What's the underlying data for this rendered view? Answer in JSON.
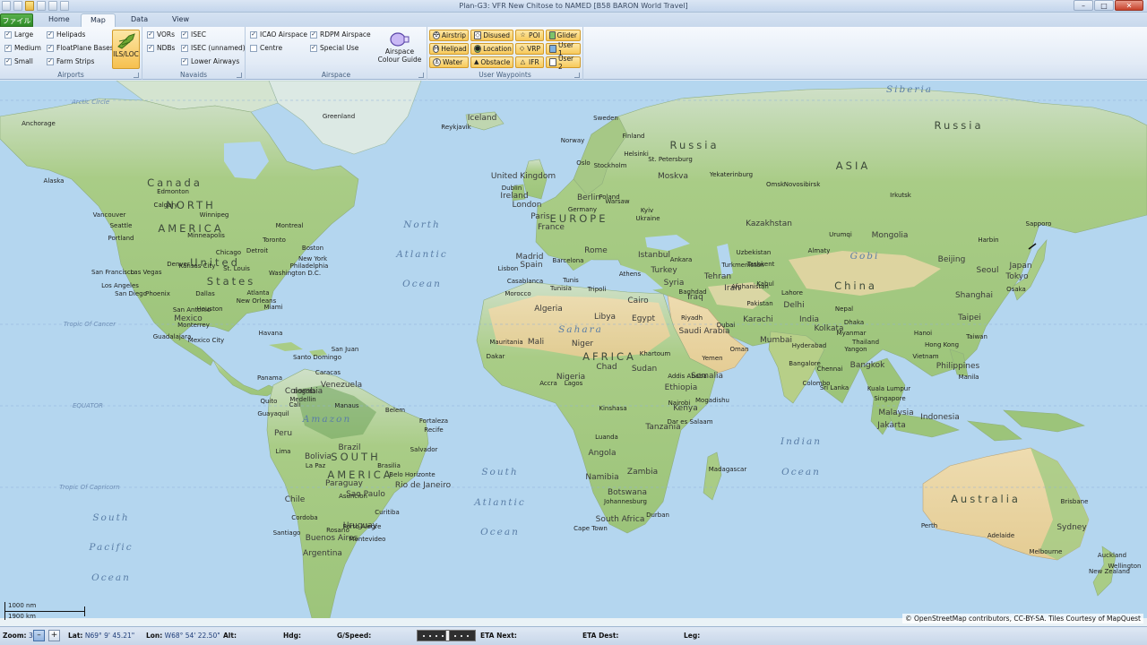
{
  "app": {
    "title": "Plan-G3: VFR New Chitose to NAMED [B58 BARON World Travel]",
    "window_buttons": [
      "–",
      "□",
      "✕"
    ]
  },
  "tabs": [
    {
      "label": "ファイル"
    },
    {
      "label": "Home"
    },
    {
      "label": "Map"
    },
    {
      "label": "Data"
    },
    {
      "label": "View"
    }
  ],
  "ribbon": {
    "airports": {
      "label": "Airports",
      "large": "Large",
      "medium": "Medium",
      "small": "Small",
      "helipads": "Helipads",
      "floatplane": "FloatPlane Bases",
      "farm": "Farm Strips",
      "ils": "ILS/LOC"
    },
    "navaids": {
      "label": "Navaids",
      "vors": "VORs",
      "ndbs": "NDBs",
      "isec": "ISEC",
      "isec_unnamed": "ISEC (unnamed)",
      "lower_airways": "Lower Airways"
    },
    "airspace": {
      "label": "Airspace",
      "icao": "ICAO Airspace",
      "centre": "Centre",
      "rdpm": "RDPM Airspace",
      "special": "Special Use",
      "colour_guide_1": "Airspace",
      "colour_guide_2": "Colour Guide"
    },
    "user_waypoints": {
      "label": "User Waypoints",
      "airstrip": "Airstrip",
      "helipad": "Helipad",
      "water": "Water",
      "disused": "Disused",
      "location": "Location",
      "obstacle": "Obstacle",
      "poi": "POI",
      "vrp": "VRP",
      "ifr": "IFR",
      "glider": "Glider",
      "user1": "User 1",
      "user2": "User 2"
    },
    "check_mark": "✓"
  },
  "map": {
    "attribution": "© OpenStreetMap contributors, CC-BY-SA. Tiles Courtesy of MapQuest",
    "scale_top": "1000 nm",
    "scale_bottom": "1900 km",
    "big_labels": [
      "Canada",
      "NORTH",
      "AMERICA",
      "United",
      "States",
      "SOUTH",
      "AMERICA",
      "AFRICA",
      "EUROPE",
      "ASIA",
      "Russia",
      "Russia",
      "China",
      "Australia",
      "Sahara",
      "Amazon",
      "Siberia",
      "Gobi"
    ],
    "oceans": [
      "North",
      "Atlantic",
      "Ocean",
      "South",
      "Atlantic",
      "Ocean",
      "Indian",
      "Ocean",
      "South",
      "Pacific",
      "Ocean"
    ],
    "notes": [
      "Arctic Circle",
      "Tropic Of Cancer",
      "EQUATOR",
      "Tropic Of Capricorn"
    ],
    "countries": [
      "Mexico",
      "Brazil",
      "Peru",
      "Bolivia",
      "Argentina",
      "Chile",
      "Paraguay",
      "Uruguay",
      "Colombia",
      "Venezuela",
      "Algeria",
      "Libya",
      "Egypt",
      "Niger",
      "Chad",
      "Sudan",
      "Mali",
      "Mauritania",
      "Nigeria",
      "Ethiopia",
      "Somalia",
      "Namibia",
      "Botswana",
      "Zambia",
      "Angola",
      "South Africa",
      "Kenya",
      "Tanzania",
      "Kazakhstan",
      "Mongolia",
      "Iran",
      "Iraq",
      "Syria",
      "Turkey",
      "Saudi Arabia",
      "Pakistan",
      "India",
      "Japan",
      "Indonesia",
      "Philippines",
      "Thailand",
      "Vietnam",
      "Myanmar",
      "Spain",
      "France",
      "Germany",
      "Ukraine",
      "Poland",
      "Finland",
      "Sweden",
      "Norway",
      "Iceland",
      "Ireland",
      "United Kingdom",
      "Greenland",
      "Alaska",
      "Madagascar",
      "New Zealand",
      "Afghanistan",
      "Uzbekistan",
      "Turkmenistan",
      "Yemen",
      "Oman",
      "Morocco",
      "Tunisia",
      "Nepal",
      "Malaysia",
      "Sri Lanka",
      "Taiwan"
    ],
    "cities": [
      "Edmonton",
      "Calgary",
      "Vancouver",
      "Seattle",
      "Portland",
      "San Francisco",
      "Los Angeles",
      "San Diego",
      "Las Vegas",
      "Phoenix",
      "Denver",
      "Dallas",
      "Houston",
      "San Antonio",
      "Chicago",
      "Detroit",
      "Toronto",
      "Montreal",
      "Boston",
      "New York",
      "Philadelphia",
      "Washington D.C.",
      "Atlanta",
      "Miami",
      "New Orleans",
      "Havana",
      "Guadalajara",
      "Mexico City",
      "Bogota",
      "Caracas",
      "Lima",
      "Quito",
      "Manaus",
      "Salvador",
      "Recife",
      "Rio de Janeiro",
      "Sao Paulo",
      "Brasilia",
      "Buenos Aires",
      "Montevideo",
      "Santiago",
      "Cordoba",
      "Reykjavik",
      "London",
      "Dublin",
      "Paris",
      "Madrid",
      "Lisbon",
      "Barcelona",
      "Rome",
      "Berlin",
      "Warsaw",
      "Kyiv",
      "Moskva",
      "St. Petersburg",
      "Stockholm",
      "Oslo",
      "Helsinki",
      "Istanbul",
      "Athens",
      "Ankara",
      "Cairo",
      "Tehran",
      "Baghdad",
      "Riyadh",
      "Dubai",
      "Karachi",
      "Mumbai",
      "Delhi",
      "Kolkata",
      "Dhaka",
      "Chennai",
      "Bangkok",
      "Hong Kong",
      "Shanghai",
      "Beijing",
      "Seoul",
      "Tokyo",
      "Osaka",
      "Manila",
      "Jakarta",
      "Singapore",
      "Kuala Lumpur",
      "Perth",
      "Adelaide",
      "Melbourne",
      "Sydney",
      "Brisbane",
      "Auckland",
      "Wellington",
      "Lagos",
      "Accra",
      "Dakar",
      "Kinshasa",
      "Luanda",
      "Nairobi",
      "Dar es Salaam",
      "Johannesburg",
      "Cape Town",
      "Durban",
      "Khartoum",
      "Addis Ababa",
      "Mogadishu",
      "Casablanca",
      "Tripoli",
      "Tunis",
      "Almaty",
      "Tashkent",
      "Urumqi",
      "Novosibirsk",
      "Omsk",
      "Yekaterinburg",
      "Irkutsk",
      "Harbin",
      "Sapporo",
      "Taipei",
      "Hanoi",
      "Yangon",
      "Kabul",
      "Lahore",
      "Hyderabad",
      "Bangalore",
      "Colombo",
      "Anchorage",
      "Winnipeg",
      "Minneapolis",
      "Kansas City",
      "St. Louis",
      "Monterrey",
      "Santo Domingo",
      "San Juan",
      "Panama",
      "Cali",
      "Medellin",
      "Guayaquil",
      "Asuncion",
      "Porto Alegre",
      "Curitiba",
      "Belo Horizonte",
      "Fortaleza",
      "Belem",
      "Rosario",
      "La Paz"
    ]
  },
  "status": {
    "zoom_label": "Zoom:",
    "zoom_value": "3",
    "zoom_minus": "–",
    "zoom_plus": "+",
    "lat_label": "Lat:",
    "lat_value": "N69° 9' 45.21\"",
    "lon_label": "Lon:",
    "lon_value": "W68° 54' 22.50\"",
    "alt_label": "Alt:",
    "hdg_label": "Hdg:",
    "gspeed_label": "G/Speed:",
    "eta_next_label": "ETA Next:",
    "eta_dest_label": "ETA Dest:",
    "leg_label": "Leg:",
    "slider_fraction": 0.53
  },
  "colors": {
    "accent": "#f7c95a",
    "file_tab": "#3a9a30",
    "ocean": "#b4d6ef"
  }
}
